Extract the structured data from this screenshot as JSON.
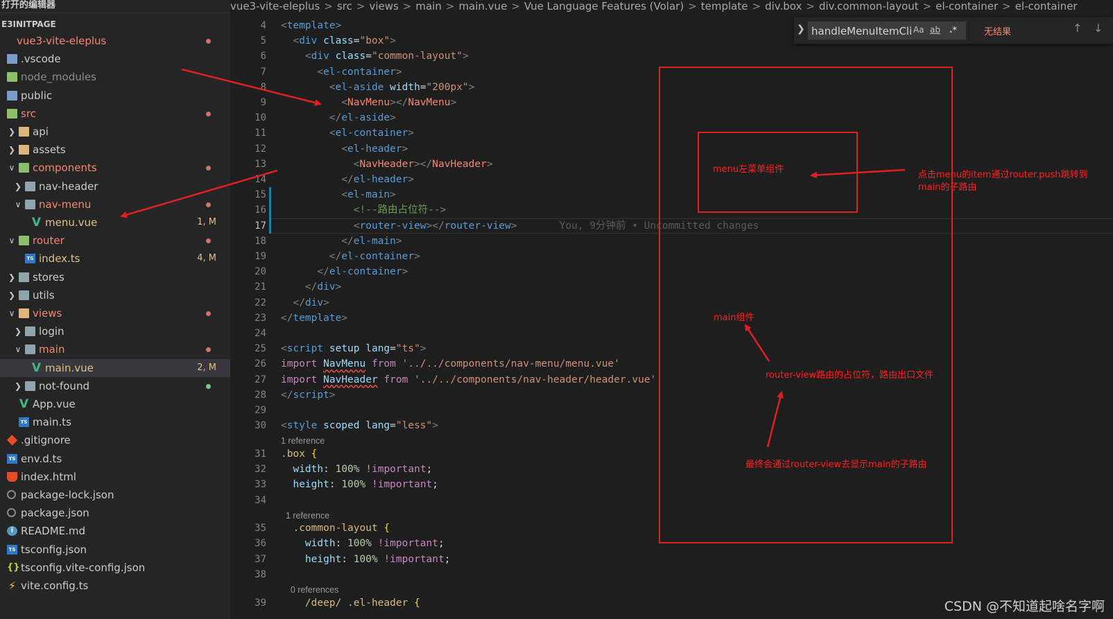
{
  "sidebar": {
    "editors_header": "打开的编辑器",
    "section_title": "E3INITPAGE",
    "items": [
      {
        "label": "vue3-vite-eleplus",
        "depth": 0,
        "chevron": "",
        "icon": "none",
        "color": "#f48771",
        "badge": "",
        "dot": "#c8766e"
      },
      {
        "label": ".vscode",
        "depth": 0,
        "chevron": "",
        "icon": "folder-blue",
        "color": "#cccccc",
        "badge": "",
        "dot": ""
      },
      {
        "label": "node_modules",
        "depth": 0,
        "chevron": "",
        "icon": "folder-green",
        "color": "#8b8b8b",
        "badge": "",
        "dot": ""
      },
      {
        "label": "public",
        "depth": 0,
        "chevron": "",
        "icon": "folder-blue",
        "color": "#cccccc",
        "badge": "",
        "dot": ""
      },
      {
        "label": "src",
        "depth": 0,
        "chevron": "",
        "icon": "folder-green",
        "color": "#f48771",
        "badge": "",
        "dot": "#c8766e"
      },
      {
        "label": "api",
        "depth": 1,
        "chevron": ">",
        "icon": "folder",
        "color": "#cccccc",
        "badge": "",
        "dot": ""
      },
      {
        "label": "assets",
        "depth": 1,
        "chevron": ">",
        "icon": "folder",
        "color": "#cccccc",
        "badge": "",
        "dot": ""
      },
      {
        "label": "components",
        "depth": 1,
        "chevron": "v",
        "icon": "folder-green",
        "color": "#f48771",
        "badge": "",
        "dot": "#c8766e"
      },
      {
        "label": "nav-header",
        "depth": 2,
        "chevron": ">",
        "icon": "grey-folder",
        "color": "#cccccc",
        "badge": "",
        "dot": ""
      },
      {
        "label": "nav-menu",
        "depth": 2,
        "chevron": "v",
        "icon": "grey-folder",
        "color": "#f48771",
        "badge": "",
        "dot": "#c8766e"
      },
      {
        "label": "menu.vue",
        "depth": 3,
        "chevron": "",
        "icon": "vue",
        "color": "#e2c08d",
        "badge": "1, M",
        "dot": ""
      },
      {
        "label": "router",
        "depth": 1,
        "chevron": "v",
        "icon": "folder-green",
        "color": "#f48771",
        "badge": "",
        "dot": "#c8766e"
      },
      {
        "label": "index.ts",
        "depth": 2,
        "chevron": "",
        "icon": "ts",
        "color": "#e2c08d",
        "badge": "4, M",
        "dot": ""
      },
      {
        "label": "stores",
        "depth": 1,
        "chevron": ">",
        "icon": "grey-folder",
        "color": "#cccccc",
        "badge": "",
        "dot": ""
      },
      {
        "label": "utils",
        "depth": 1,
        "chevron": ">",
        "icon": "grey-folder",
        "color": "#cccccc",
        "badge": "",
        "dot": ""
      },
      {
        "label": "views",
        "depth": 1,
        "chevron": "v",
        "icon": "folder",
        "color": "#f48771",
        "badge": "",
        "dot": "#c8766e"
      },
      {
        "label": "login",
        "depth": 2,
        "chevron": ">",
        "icon": "grey-folder",
        "color": "#cccccc",
        "badge": "",
        "dot": ""
      },
      {
        "label": "main",
        "depth": 2,
        "chevron": "v",
        "icon": "grey-folder",
        "color": "#f48771",
        "badge": "",
        "dot": "#c8766e"
      },
      {
        "label": "main.vue",
        "depth": 3,
        "chevron": "",
        "icon": "vue",
        "color": "#e2c08d",
        "badge": "2, M",
        "dot": "",
        "selected": true
      },
      {
        "label": "not-found",
        "depth": 2,
        "chevron": ">",
        "icon": "grey-folder",
        "color": "#cccccc",
        "badge": "",
        "dot": "#73c991"
      },
      {
        "label": "App.vue",
        "depth": 1,
        "chevron": "",
        "icon": "vue",
        "color": "#cccccc",
        "badge": "",
        "dot": ""
      },
      {
        "label": "main.ts",
        "depth": 1,
        "chevron": "",
        "icon": "ts",
        "color": "#cccccc",
        "badge": "",
        "dot": ""
      },
      {
        "label": ".gitignore",
        "depth": 0,
        "chevron": "",
        "icon": "git",
        "color": "#cccccc",
        "badge": "",
        "dot": ""
      },
      {
        "label": "env.d.ts",
        "depth": 0,
        "chevron": "",
        "icon": "ts",
        "color": "#cccccc",
        "badge": "",
        "dot": ""
      },
      {
        "label": "index.html",
        "depth": 0,
        "chevron": "",
        "icon": "html",
        "color": "#cccccc",
        "badge": "",
        "dot": ""
      },
      {
        "label": "package-lock.json",
        "depth": 0,
        "chevron": "",
        "icon": "gear",
        "color": "#cccccc",
        "badge": "",
        "dot": ""
      },
      {
        "label": "package.json",
        "depth": 0,
        "chevron": "",
        "icon": "gear",
        "color": "#cccccc",
        "badge": "",
        "dot": ""
      },
      {
        "label": "README.md",
        "depth": 0,
        "chevron": "",
        "icon": "info",
        "color": "#cccccc",
        "badge": "",
        "dot": ""
      },
      {
        "label": "tsconfig.json",
        "depth": 0,
        "chevron": "",
        "icon": "ts",
        "color": "#cccccc",
        "badge": "",
        "dot": ""
      },
      {
        "label": "tsconfig.vite-config.json",
        "depth": 0,
        "chevron": "",
        "icon": "cfg",
        "color": "#cccccc",
        "badge": "",
        "dot": ""
      },
      {
        "label": "vite.config.ts",
        "depth": 0,
        "chevron": "",
        "icon": "vite",
        "color": "#cccccc",
        "badge": "",
        "dot": ""
      }
    ]
  },
  "breadcrumb": [
    "vue3-vite-eleplus",
    "src",
    "views",
    "main",
    "main.vue",
    "Vue Language Features (Volar)",
    "template",
    "div.box",
    "div.common-layout",
    "el-container",
    "el-container"
  ],
  "find": {
    "value": "handleMenuItemClic",
    "match_case": "Aa",
    "whole_word": "ab",
    "regex": ".*",
    "result": "无结果",
    "prev_icon": "↑",
    "next_icon": "↓"
  },
  "editor": {
    "active_line": "17",
    "git_blame": "You, 9分钟前 • Uncommitted changes",
    "lines": [
      {
        "n": "4",
        "segs": [
          [
            "t-punc",
            "<"
          ],
          [
            "t-tag",
            "template"
          ],
          [
            "t-punc",
            ">"
          ]
        ]
      },
      {
        "n": "5",
        "segs": [
          [
            "",
            "  "
          ],
          [
            "t-punc",
            "<"
          ],
          [
            "t-tag",
            "div"
          ],
          [
            "",
            ""
          ],
          [
            "t-attr",
            " class"
          ],
          [
            "",
            "="
          ],
          [
            "t-str",
            "\"box\""
          ],
          [
            "t-punc",
            ">"
          ]
        ]
      },
      {
        "n": "6",
        "segs": [
          [
            "",
            "    "
          ],
          [
            "t-punc",
            "<"
          ],
          [
            "t-tag",
            "div"
          ],
          [
            "t-attr",
            " class"
          ],
          [
            "",
            "="
          ],
          [
            "t-str",
            "\"common-layout\""
          ],
          [
            "t-punc",
            ">"
          ]
        ]
      },
      {
        "n": "7",
        "segs": [
          [
            "",
            "      "
          ],
          [
            "t-punc",
            "<"
          ],
          [
            "t-tag",
            "el-container"
          ],
          [
            "t-punc",
            ">"
          ]
        ]
      },
      {
        "n": "8",
        "segs": [
          [
            "",
            "        "
          ],
          [
            "t-punc",
            "<"
          ],
          [
            "t-tag",
            "el-aside"
          ],
          [
            "t-attr",
            " width"
          ],
          [
            "",
            "="
          ],
          [
            "t-str",
            "\"200px\""
          ],
          [
            "t-punc",
            ">"
          ]
        ]
      },
      {
        "n": "9",
        "segs": [
          [
            "",
            "          "
          ],
          [
            "t-punc",
            "<"
          ],
          [
            "t-comp",
            "NavMenu"
          ],
          [
            "t-punc",
            "></"
          ],
          [
            "t-comp",
            "NavMenu"
          ],
          [
            "t-punc",
            ">"
          ]
        ]
      },
      {
        "n": "10",
        "segs": [
          [
            "",
            "        "
          ],
          [
            "t-punc",
            "</"
          ],
          [
            "t-tag",
            "el-aside"
          ],
          [
            "t-punc",
            ">"
          ]
        ]
      },
      {
        "n": "11",
        "segs": [
          [
            "",
            "        "
          ],
          [
            "t-punc",
            "<"
          ],
          [
            "t-tag",
            "el-container"
          ],
          [
            "t-punc",
            ">"
          ]
        ]
      },
      {
        "n": "12",
        "segs": [
          [
            "",
            "          "
          ],
          [
            "t-punc",
            "<"
          ],
          [
            "t-tag",
            "el-header"
          ],
          [
            "t-punc",
            ">"
          ]
        ]
      },
      {
        "n": "13",
        "segs": [
          [
            "",
            "            "
          ],
          [
            "t-punc",
            "<"
          ],
          [
            "t-comp",
            "NavHeader"
          ],
          [
            "t-punc",
            "></"
          ],
          [
            "t-comp",
            "NavHeader"
          ],
          [
            "t-punc",
            ">"
          ]
        ]
      },
      {
        "n": "14",
        "segs": [
          [
            "",
            "          "
          ],
          [
            "t-punc",
            "</"
          ],
          [
            "t-tag",
            "el-header"
          ],
          [
            "t-punc",
            ">"
          ]
        ]
      },
      {
        "n": "15",
        "segs": [
          [
            "",
            "          "
          ],
          [
            "t-punc",
            "<"
          ],
          [
            "t-tag",
            "el-main"
          ],
          [
            "t-punc",
            ">"
          ]
        ]
      },
      {
        "n": "16",
        "segs": [
          [
            "",
            "            "
          ],
          [
            "t-comment",
            "<!--路由占位符-->"
          ]
        ]
      },
      {
        "n": "17",
        "segs": [
          [
            "",
            "            "
          ],
          [
            "t-punc",
            "<"
          ],
          [
            "t-tag",
            "router-view"
          ],
          [
            "t-punc",
            "></"
          ],
          [
            "t-tag",
            "router-view"
          ],
          [
            "t-punc",
            ">"
          ]
        ]
      },
      {
        "n": "18",
        "segs": [
          [
            "",
            "          "
          ],
          [
            "t-punc",
            "</"
          ],
          [
            "t-tag",
            "el-main"
          ],
          [
            "t-punc",
            ">"
          ]
        ]
      },
      {
        "n": "19",
        "segs": [
          [
            "",
            "        "
          ],
          [
            "t-punc",
            "</"
          ],
          [
            "t-tag",
            "el-container"
          ],
          [
            "t-punc",
            ">"
          ]
        ]
      },
      {
        "n": "20",
        "segs": [
          [
            "",
            "      "
          ],
          [
            "t-punc",
            "</"
          ],
          [
            "t-tag",
            "el-container"
          ],
          [
            "t-punc",
            ">"
          ]
        ]
      },
      {
        "n": "21",
        "segs": [
          [
            "",
            "    "
          ],
          [
            "t-punc",
            "</"
          ],
          [
            "t-tag",
            "div"
          ],
          [
            "t-punc",
            ">"
          ]
        ]
      },
      {
        "n": "22",
        "segs": [
          [
            "",
            "  "
          ],
          [
            "t-punc",
            "</"
          ],
          [
            "t-tag",
            "div"
          ],
          [
            "t-punc",
            ">"
          ]
        ]
      },
      {
        "n": "23",
        "segs": [
          [
            "t-punc",
            "</"
          ],
          [
            "t-tag",
            "template"
          ],
          [
            "t-punc",
            ">"
          ]
        ]
      },
      {
        "n": "24",
        "segs": []
      },
      {
        "n": "25",
        "segs": [
          [
            "t-punc",
            "<"
          ],
          [
            "t-tag",
            "script"
          ],
          [
            "t-attr",
            " setup"
          ],
          [
            "t-attr",
            " lang"
          ],
          [
            "",
            "="
          ],
          [
            "t-str",
            "\"ts\""
          ],
          [
            "t-punc",
            ">"
          ]
        ]
      },
      {
        "n": "26",
        "segs": [
          [
            "t-kw",
            "import"
          ],
          [
            "",
            " "
          ],
          [
            "t-id squig",
            "NavMenu"
          ],
          [
            "t-kw",
            " from"
          ],
          [
            "",
            " "
          ],
          [
            "t-str",
            "'../../components/nav-menu/menu.vue'"
          ]
        ]
      },
      {
        "n": "27",
        "segs": [
          [
            "t-kw",
            "import"
          ],
          [
            "",
            " "
          ],
          [
            "t-id squig",
            "NavHeader"
          ],
          [
            "t-kw",
            " from"
          ],
          [
            "",
            " "
          ],
          [
            "t-str",
            "'../../components/nav-header/header.vue'"
          ]
        ]
      },
      {
        "n": "28",
        "segs": [
          [
            "t-punc",
            "</"
          ],
          [
            "t-tag",
            "script"
          ],
          [
            "t-punc",
            ">"
          ]
        ]
      },
      {
        "n": "29",
        "segs": []
      },
      {
        "n": "30",
        "segs": [
          [
            "t-punc",
            "<"
          ],
          [
            "t-tag",
            "style"
          ],
          [
            "t-attr",
            " scoped"
          ],
          [
            "t-attr",
            " lang"
          ],
          [
            "",
            "="
          ],
          [
            "t-str",
            "\"less\""
          ],
          [
            "t-punc",
            ">"
          ]
        ]
      },
      {
        "n": "",
        "lens": "1 reference"
      },
      {
        "n": "31",
        "segs": [
          [
            "t-sel",
            ".box"
          ],
          [
            "",
            " "
          ],
          [
            "t-br",
            "{"
          ]
        ]
      },
      {
        "n": "32",
        "segs": [
          [
            "",
            "  "
          ],
          [
            "t-prop",
            "width"
          ],
          [
            "",
            ": "
          ],
          [
            "t-num",
            "100%"
          ],
          [
            "",
            " "
          ],
          [
            "t-kw",
            "!important"
          ],
          [
            "",
            ";"
          ]
        ]
      },
      {
        "n": "33",
        "segs": [
          [
            "",
            "  "
          ],
          [
            "t-prop",
            "height"
          ],
          [
            "",
            ": "
          ],
          [
            "t-num",
            "100%"
          ],
          [
            "",
            " "
          ],
          [
            "t-kw",
            "!important"
          ],
          [
            "",
            ";"
          ]
        ]
      },
      {
        "n": "34",
        "segs": []
      },
      {
        "n": "",
        "lens": "  1 reference"
      },
      {
        "n": "35",
        "segs": [
          [
            "",
            "  "
          ],
          [
            "t-sel",
            ".common-layout"
          ],
          [
            "",
            " "
          ],
          [
            "t-br",
            "{"
          ]
        ]
      },
      {
        "n": "36",
        "segs": [
          [
            "",
            "    "
          ],
          [
            "t-prop",
            "width"
          ],
          [
            "",
            ": "
          ],
          [
            "t-num",
            "100%"
          ],
          [
            "",
            " "
          ],
          [
            "t-kw",
            "!important"
          ],
          [
            "",
            ";"
          ]
        ]
      },
      {
        "n": "37",
        "segs": [
          [
            "",
            "    "
          ],
          [
            "t-prop",
            "height"
          ],
          [
            "",
            ": "
          ],
          [
            "t-num",
            "100%"
          ],
          [
            "",
            " "
          ],
          [
            "t-kw",
            "!important"
          ],
          [
            "",
            ";"
          ]
        ]
      },
      {
        "n": "38",
        "segs": []
      },
      {
        "n": "",
        "lens": "    0 references"
      },
      {
        "n": "39",
        "segs": [
          [
            "",
            "    "
          ],
          [
            "t-sel",
            "/deep/ .el-header"
          ],
          [
            "",
            " "
          ],
          [
            "t-br",
            "{"
          ]
        ]
      }
    ]
  },
  "annotations": {
    "menu_label": "menu左菜单组件",
    "click_note_line1": "点击menu的item通过router.push跳转到",
    "click_note_line2": "main的子路由",
    "main_label": "main组件",
    "router_view_note": "router-view路由的占位符，路由出口文件",
    "final_note": "最终会通过router-view去显示main的子路由"
  },
  "watermark": "CSDN @不知道起啥名字啊"
}
